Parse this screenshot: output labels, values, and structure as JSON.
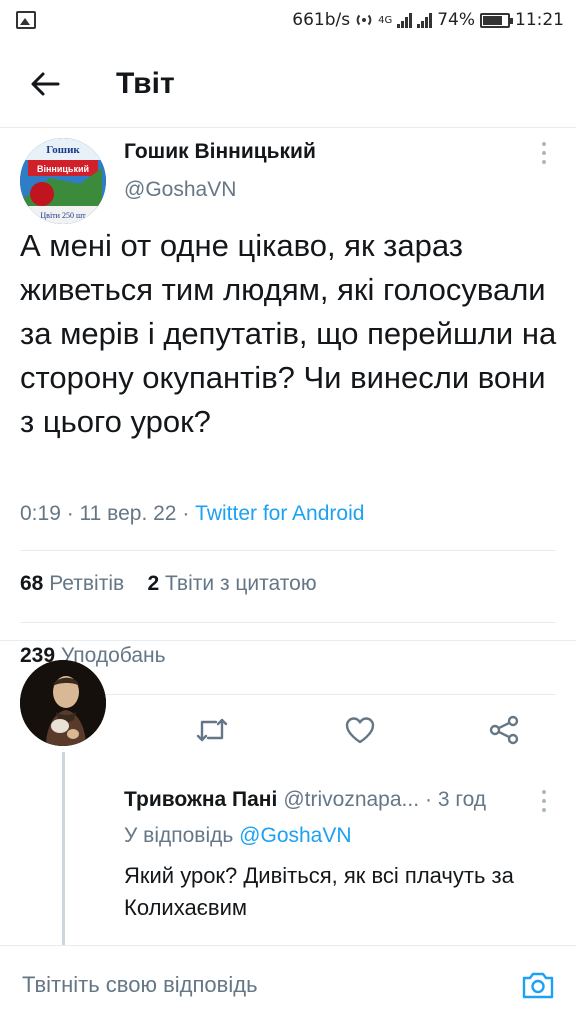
{
  "status_bar": {
    "speed": "661b/s",
    "network": "4G",
    "battery": "74%",
    "time": "11:21"
  },
  "header": {
    "title": "Твіт"
  },
  "tweet": {
    "author_name": "Гошик Вінницький",
    "author_handle": "@GoshaVN",
    "text": "А мені от одне цікаво, як зараз живеться тим людям, які голосували за мерів і депутатів, що перейшли на сторону окупантів? Чи винесли вони з цього урок?",
    "time": "0:19",
    "date": "11 вер. 22",
    "source": "Twitter for Android",
    "retweets_count": "68",
    "retweets_label": "Ретвітів",
    "quotes_count": "2",
    "quotes_label": "Твіти з цитатою",
    "likes_count": "239",
    "likes_label": "Уподобань",
    "avatar_text_top": "Гошик",
    "avatar_text_mid": "Вінницький",
    "avatar_text_bottom": "Цвіти 250 шт"
  },
  "reply": {
    "name": "Тривожна Пані",
    "handle": "@trivoznapa...",
    "time": "· 3 год",
    "reply_to_label": "У відповідь",
    "reply_to_handle": "@GoshaVN",
    "text": "Який урок? Дивіться, як всі плачуть за Колихаєвим"
  },
  "compose": {
    "placeholder": "Твітніть свою відповідь"
  },
  "colors": {
    "accent": "#1da1f2",
    "secondary_text": "#657786",
    "primary_text": "#14171a",
    "divider": "#e6ecf0"
  },
  "icons": [
    "back-arrow-icon",
    "more-icon",
    "reply-icon",
    "retweet-icon",
    "like-icon",
    "share-icon",
    "camera-icon"
  ]
}
